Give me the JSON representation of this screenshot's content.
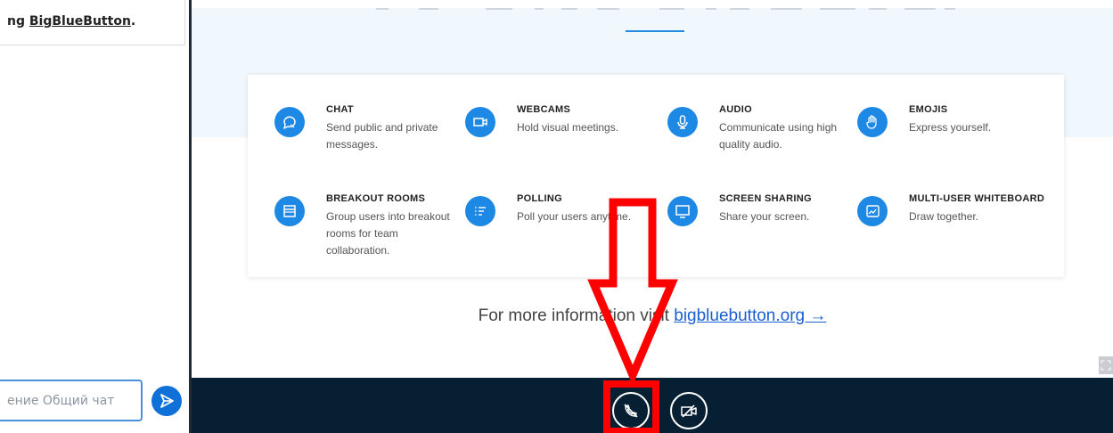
{
  "chat": {
    "message_prefix": "ng ",
    "message_link": "BigBlueButton",
    "message_suffix": ".",
    "input_placeholder": "ение Общий чат"
  },
  "features": [
    {
      "title": "CHAT",
      "desc": "Send public and private messages.",
      "icon": "chat-icon"
    },
    {
      "title": "WEBCAMS",
      "desc": "Hold visual meetings.",
      "icon": "webcam-icon"
    },
    {
      "title": "AUDIO",
      "desc": "Communicate using high quality audio.",
      "icon": "microphone-icon"
    },
    {
      "title": "EMOJIS",
      "desc": "Express yourself.",
      "icon": "hand-icon"
    },
    {
      "title": "BREAKOUT ROOMS",
      "desc": "Group users into breakout rooms for team collaboration.",
      "icon": "breakout-icon"
    },
    {
      "title": "POLLING",
      "desc": "Poll your users anytime.",
      "icon": "list-icon"
    },
    {
      "title": "SCREEN SHARING",
      "desc": "Share your screen.",
      "icon": "monitor-icon"
    },
    {
      "title": "MULTI-USER WHITEBOARD",
      "desc": "Draw together.",
      "icon": "whiteboard-icon"
    }
  ],
  "more_info": {
    "prefix": "For more information visit ",
    "link": "bigbluebutton.org →"
  },
  "colors": {
    "accent": "#1e88e5",
    "action_bar": "#071f33",
    "annotation": "#ff0000"
  }
}
